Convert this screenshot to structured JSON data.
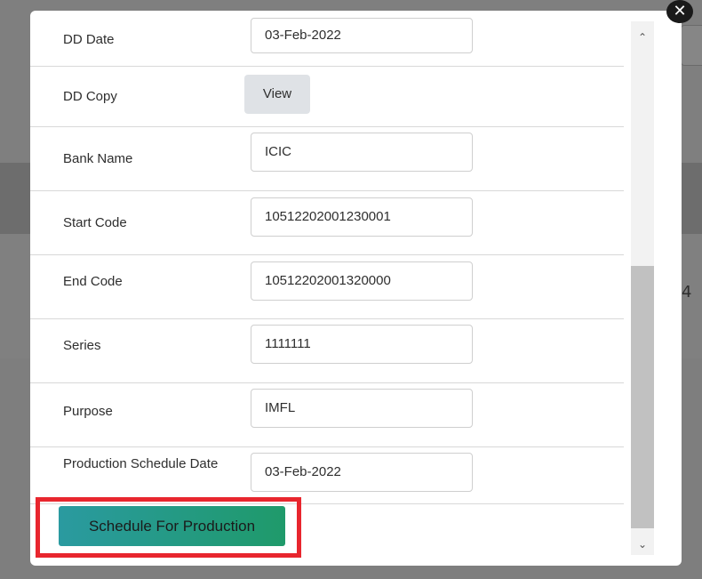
{
  "modal": {
    "close_glyph": "✕",
    "fields": [
      {
        "label": "DD Date",
        "value": "03-Feb-2022"
      },
      {
        "label": "DD Copy",
        "button": "View"
      },
      {
        "label": "Bank Name",
        "value": "ICIC"
      },
      {
        "label": "Start Code",
        "value": "10512202001230001"
      },
      {
        "label": "End Code",
        "value": "10512202001320000"
      },
      {
        "label": "Series",
        "value": "1111111"
      },
      {
        "label": "Purpose",
        "value": "IMFL"
      },
      {
        "label": "Production Schedule Date",
        "value": "03-Feb-2022"
      }
    ],
    "schedule_button": "Schedule For Production"
  },
  "scrollbar": {
    "up_glyph": "⌃",
    "down_glyph": "⌄"
  },
  "background": {
    "side_number": "4"
  },
  "colors": {
    "highlight": "#e8262e",
    "button_gradient_start": "#2a9aa0",
    "button_gradient_end": "#1f9a6a"
  }
}
